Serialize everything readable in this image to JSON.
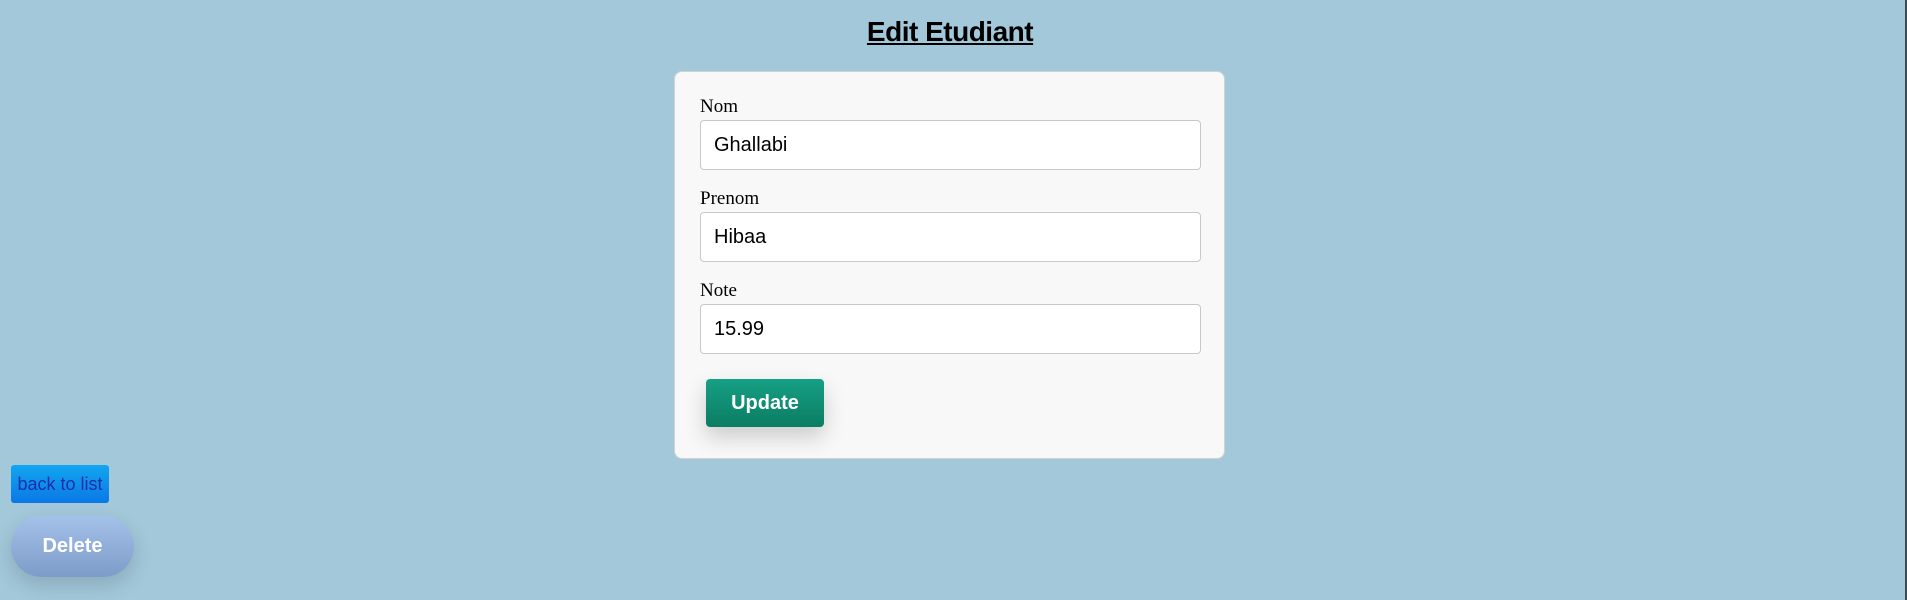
{
  "page": {
    "title": "Edit Etudiant"
  },
  "form": {
    "fields": [
      {
        "label": "Nom",
        "value": "Ghallabi"
      },
      {
        "label": "Prenom",
        "value": "Hibaa"
      },
      {
        "label": "Note",
        "value": "15.99"
      }
    ],
    "update_label": "Update"
  },
  "actions": {
    "back_label": "back to list",
    "delete_label": "Delete"
  },
  "colors": {
    "background": "#a2c8da",
    "card": "#f8f8f8",
    "update_button": "#16a085",
    "back_button": "#0a78e6",
    "delete_button": "#7d9cc8"
  }
}
